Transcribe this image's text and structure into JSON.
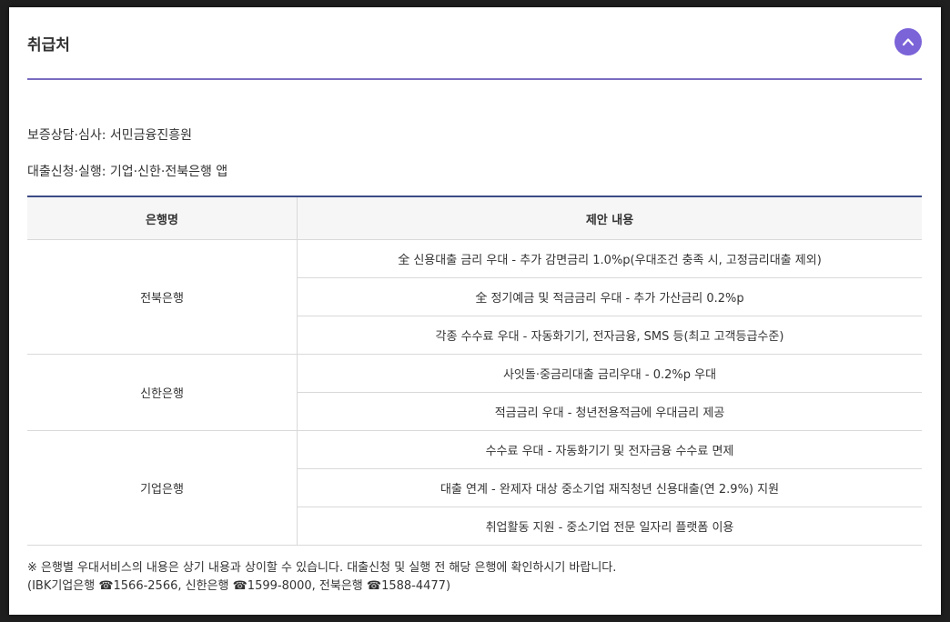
{
  "section": {
    "title": "취급처"
  },
  "info": {
    "consult": "보증상담·심사: 서민금융진흥원",
    "loan": "대출신청·실행: 기업·신한·전북은행 앱"
  },
  "table": {
    "headers": [
      "은행명",
      "제안 내용"
    ],
    "banks": [
      {
        "name": "전북은행",
        "items": [
          "全 신용대출 금리 우대 - 추가 감면금리 1.0%p(우대조건 충족 시, 고정금리대출 제외)",
          "全 정기예금 및 적금금리 우대 - 추가 가산금리 0.2%p",
          "각종 수수료 우대 - 자동화기기, 전자금융, SMS 등(최고 고객등급수준)"
        ]
      },
      {
        "name": "신한은행",
        "items": [
          "사잇돌·중금리대출 금리우대 - 0.2%p 우대",
          "적금금리 우대 - 청년전용적금에 우대금리 제공"
        ]
      },
      {
        "name": "기업은행",
        "items": [
          "수수료 우대 - 자동화기기 및 전자금융 수수료 면제",
          "대출 연계 - 완제자 대상 중소기업 재직청년 신용대출(연 2.9%) 지원",
          "취업활동 지원 - 중소기업 전문 일자리 플랫폼 이용"
        ]
      }
    ]
  },
  "notes": {
    "line1": "※ 은행별 우대서비스의 내용은 상기 내용과 상이할 수 있습니다. 대출신청 및 실행 전 해당 은행에 확인하시기 바랍니다.",
    "line2": "(IBK기업은행 ☎1566-2566, 신한은행 ☎1599-8000, 전북은행 ☎1588-4477)"
  },
  "icons": {
    "toggle": "chevron-up-icon"
  },
  "colors": {
    "accent": "#7b63d8",
    "header_rule": "#7a6bc0",
    "table_top": "#3b4b86"
  }
}
